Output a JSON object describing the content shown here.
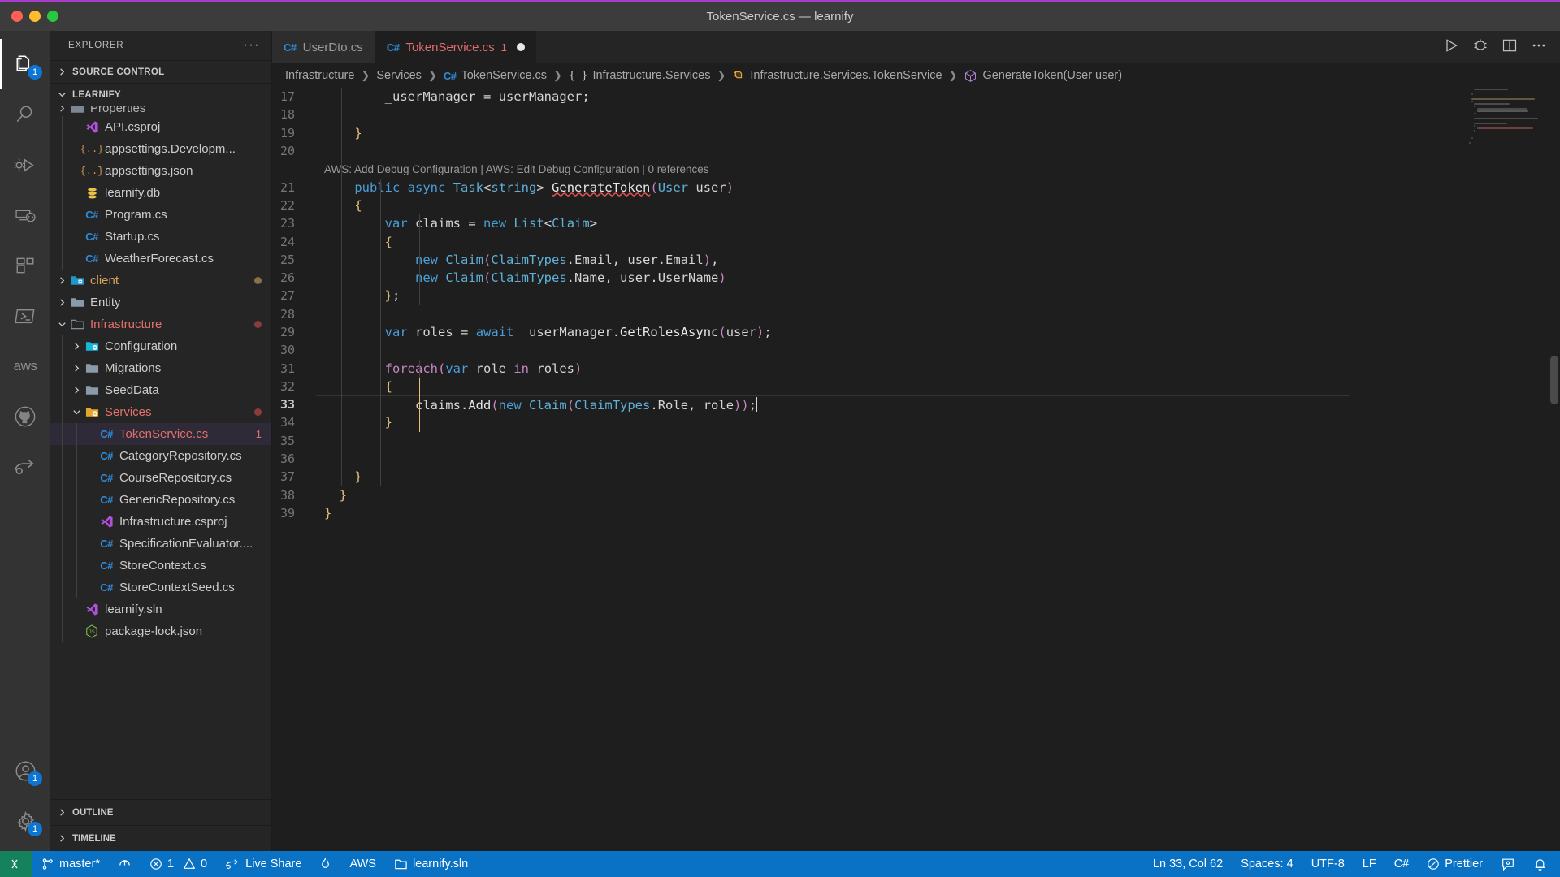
{
  "window": {
    "title": "TokenService.cs — learnify",
    "traffic_lights": [
      "close",
      "minimize",
      "maximize"
    ]
  },
  "activity_bar": {
    "items": [
      {
        "name": "explorer",
        "icon": "files-icon",
        "badge": "1",
        "active": true
      },
      {
        "name": "search",
        "icon": "search-icon",
        "badge": null,
        "active": false
      },
      {
        "name": "run-and-debug",
        "icon": "debug-icon",
        "badge": null,
        "active": false
      },
      {
        "name": "remote-explorer",
        "icon": "remote-icon",
        "badge": null,
        "active": false
      },
      {
        "name": "extensions",
        "icon": "extensions-icon",
        "badge": null,
        "active": false
      },
      {
        "name": "terminal",
        "icon": "powershell-icon",
        "badge": null,
        "active": false
      },
      {
        "name": "aws-toolkit",
        "icon": "aws-icon",
        "label": "aws",
        "badge": null,
        "active": false
      },
      {
        "name": "github",
        "icon": "github-icon",
        "badge": null,
        "active": false
      },
      {
        "name": "live-share",
        "icon": "live-share-icon",
        "badge": null,
        "active": false
      }
    ],
    "bottom_items": [
      {
        "name": "accounts",
        "icon": "account-icon",
        "badge": "1"
      },
      {
        "name": "settings",
        "icon": "gear-icon",
        "badge": "1"
      }
    ]
  },
  "sidebar": {
    "header": "EXPLORER",
    "more_actions": "···",
    "sections": [
      {
        "name": "source-control",
        "label": "SOURCE CONTROL",
        "expanded": false
      },
      {
        "name": "learnify",
        "label": "LEARNIFY",
        "expanded": true
      }
    ],
    "bottom_sections": [
      {
        "name": "outline",
        "label": "OUTLINE",
        "expanded": false
      },
      {
        "name": "timeline",
        "label": "TIMELINE",
        "expanded": false
      }
    ],
    "tree": [
      {
        "label": "Properties",
        "icon": "folder-icon",
        "indent": 1,
        "twisty": "collapsed",
        "state": "normal",
        "clipped": true
      },
      {
        "label": "API.csproj",
        "icon": "visualstudio-icon",
        "indent": 2,
        "twisty": "none",
        "state": "normal"
      },
      {
        "label": "appsettings.Developm...",
        "icon": "json-icon",
        "indent": 2,
        "twisty": "none",
        "state": "normal"
      },
      {
        "label": "appsettings.json",
        "icon": "json-icon",
        "indent": 2,
        "twisty": "none",
        "state": "normal"
      },
      {
        "label": "learnify.db",
        "icon": "database-icon",
        "indent": 2,
        "twisty": "none",
        "state": "normal"
      },
      {
        "label": "Program.cs",
        "icon": "csharp-icon",
        "indent": 2,
        "twisty": "none",
        "state": "normal"
      },
      {
        "label": "Startup.cs",
        "icon": "csharp-icon",
        "indent": 2,
        "twisty": "none",
        "state": "normal"
      },
      {
        "label": "WeatherForecast.cs",
        "icon": "csharp-icon",
        "indent": 2,
        "twisty": "none",
        "state": "normal"
      },
      {
        "label": "client",
        "icon": "folder-client-icon",
        "indent": 1,
        "twisty": "collapsed",
        "state": "untracked",
        "dot": "#8a7047"
      },
      {
        "label": "Entity",
        "icon": "folder-icon",
        "indent": 1,
        "twisty": "collapsed",
        "state": "normal"
      },
      {
        "label": "Infrastructure",
        "icon": "folder-open-icon",
        "indent": 1,
        "twisty": "expanded",
        "state": "modified",
        "dot": "#8a3b3b"
      },
      {
        "label": "Configuration",
        "icon": "folder-config-icon",
        "indent": 2,
        "twisty": "collapsed",
        "state": "normal"
      },
      {
        "label": "Migrations",
        "icon": "folder-icon",
        "indent": 2,
        "twisty": "collapsed",
        "state": "normal"
      },
      {
        "label": "SeedData",
        "icon": "folder-icon",
        "indent": 2,
        "twisty": "collapsed",
        "state": "normal"
      },
      {
        "label": "Services",
        "icon": "folder-open-services-icon",
        "indent": 2,
        "twisty": "expanded",
        "state": "modified",
        "dot": "#8a3b3b"
      },
      {
        "label": "TokenService.cs",
        "icon": "csharp-icon",
        "indent": 3,
        "twisty": "none",
        "state": "modified",
        "count": "1",
        "selected": true
      },
      {
        "label": "CategoryRepository.cs",
        "icon": "csharp-icon",
        "indent": 3,
        "twisty": "none",
        "state": "normal"
      },
      {
        "label": "CourseRepository.cs",
        "icon": "csharp-icon",
        "indent": 3,
        "twisty": "none",
        "state": "normal"
      },
      {
        "label": "GenericRepository.cs",
        "icon": "csharp-icon",
        "indent": 3,
        "twisty": "none",
        "state": "normal"
      },
      {
        "label": "Infrastructure.csproj",
        "icon": "visualstudio-icon",
        "indent": 3,
        "twisty": "none",
        "state": "normal"
      },
      {
        "label": "SpecificationEvaluator....",
        "icon": "csharp-icon",
        "indent": 3,
        "twisty": "none",
        "state": "normal"
      },
      {
        "label": "StoreContext.cs",
        "icon": "csharp-icon",
        "indent": 3,
        "twisty": "none",
        "state": "normal"
      },
      {
        "label": "StoreContextSeed.cs",
        "icon": "csharp-icon",
        "indent": 3,
        "twisty": "none",
        "state": "normal"
      },
      {
        "label": "learnify.sln",
        "icon": "visualstudio-icon",
        "indent": 2,
        "twisty": "none",
        "state": "normal"
      },
      {
        "label": "package-lock.json",
        "icon": "nodejs-icon",
        "indent": 2,
        "twisty": "none",
        "state": "normal"
      }
    ]
  },
  "tabs": [
    {
      "label": "UserDto.cs",
      "icon": "csharp-icon",
      "active": false,
      "dirty": false,
      "count": null
    },
    {
      "label": "TokenService.cs",
      "icon": "csharp-icon",
      "active": true,
      "dirty": true,
      "count": "1"
    }
  ],
  "editor_actions": [
    {
      "name": "run-button",
      "icon": "play-icon"
    },
    {
      "name": "run-and-debug-button",
      "icon": "debug-alt-icon"
    },
    {
      "name": "split-editor-button",
      "icon": "split-icon"
    },
    {
      "name": "more-actions-button",
      "icon": "ellipsis-icon"
    }
  ],
  "breadcrumb": [
    {
      "label": "Infrastructure",
      "icon": null
    },
    {
      "label": "Services",
      "icon": null
    },
    {
      "label": "TokenService.cs",
      "icon": "csharp-icon"
    },
    {
      "label": "Infrastructure.Services",
      "icon": "namespace-icon"
    },
    {
      "label": "Infrastructure.Services.TokenService",
      "icon": "class-icon"
    },
    {
      "label": "GenerateToken(User user)",
      "icon": "method-icon"
    }
  ],
  "editor": {
    "filename": "TokenService.cs",
    "language": "C#",
    "codelens": "AWS: Add Debug Configuration | AWS: Edit Debug Configuration | 0 references",
    "current_line": 33,
    "first_line": 17,
    "lines": [
      {
        "no": 17,
        "text": "        _userManager = userManager;"
      },
      {
        "no": 18,
        "text": ""
      },
      {
        "no": 19,
        "text": "    }"
      },
      {
        "no": 20,
        "text": ""
      },
      {
        "no": 21,
        "text": "    public async Task<string> GenerateToken(User user)"
      },
      {
        "no": 22,
        "text": "    {"
      },
      {
        "no": 23,
        "text": "        var claims = new List<Claim>"
      },
      {
        "no": 24,
        "text": "        {"
      },
      {
        "no": 25,
        "text": "            new Claim(ClaimTypes.Email, user.Email),"
      },
      {
        "no": 26,
        "text": "            new Claim(ClaimTypes.Name, user.UserName)"
      },
      {
        "no": 27,
        "text": "        };"
      },
      {
        "no": 28,
        "text": ""
      },
      {
        "no": 29,
        "text": "        var roles = await _userManager.GetRolesAsync(user);"
      },
      {
        "no": 30,
        "text": ""
      },
      {
        "no": 31,
        "text": "        foreach(var role in roles)"
      },
      {
        "no": 32,
        "text": "        {"
      },
      {
        "no": 33,
        "text": "            claims.Add(new Claim(ClaimTypes.Role, role));"
      },
      {
        "no": 34,
        "text": "        }"
      },
      {
        "no": 35,
        "text": ""
      },
      {
        "no": 36,
        "text": ""
      },
      {
        "no": 37,
        "text": "    }"
      },
      {
        "no": 38,
        "text": "  }"
      },
      {
        "no": 39,
        "text": "}"
      }
    ]
  },
  "status_bar": {
    "remote": {
      "label": "",
      "icon": "remote-icon"
    },
    "left": [
      {
        "name": "branch",
        "icon": "git-branch-icon",
        "label": "master*"
      },
      {
        "name": "sync-changes",
        "icon": "sync-icon",
        "label": ""
      },
      {
        "name": "problems",
        "icon": "error-icon",
        "label": "1",
        "icon2": "warning-icon",
        "label2": "0"
      },
      {
        "name": "live-share",
        "icon": "live-share-icon",
        "label": "Live Share"
      },
      {
        "name": "flame",
        "icon": "flame-icon",
        "label": ""
      },
      {
        "name": "aws",
        "icon": null,
        "label": "AWS"
      },
      {
        "name": "solution",
        "icon": "solution-icon",
        "label": "learnify.sln"
      }
    ],
    "right": [
      {
        "name": "cursor-position",
        "label": "Ln 33, Col 62"
      },
      {
        "name": "indentation",
        "label": "Spaces: 4"
      },
      {
        "name": "encoding",
        "label": "UTF-8"
      },
      {
        "name": "eol",
        "label": "LF"
      },
      {
        "name": "language-mode",
        "label": "C#"
      },
      {
        "name": "prettier",
        "icon": "prettier-icon",
        "label": "Prettier"
      },
      {
        "name": "feedback",
        "icon": "feedback-icon",
        "label": ""
      },
      {
        "name": "notifications",
        "icon": "bell-icon",
        "label": ""
      }
    ]
  },
  "colors": {
    "accent": "#0a72c4",
    "remote_green": "#16825d",
    "modified_red": "#e2706b",
    "untracked_yellow": "#d7a35c",
    "titlebar": "#3c3c3c",
    "sidebar": "#252526",
    "editor": "#1e1e1e",
    "activitybar": "#333333",
    "purple_border": "#a93dce"
  }
}
